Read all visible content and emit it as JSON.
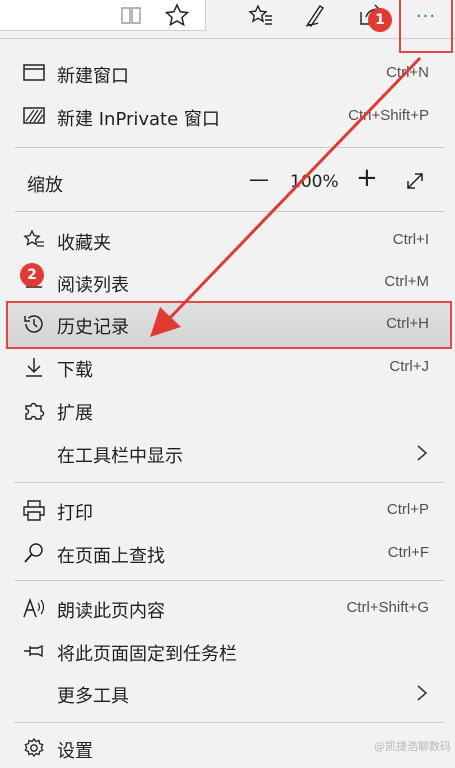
{
  "menu": {
    "new_window": {
      "label": "新建窗口",
      "shortcut": "Ctrl+N"
    },
    "new_inprivate": {
      "label": "新建 InPrivate 窗口",
      "shortcut": "Ctrl+Shift+P"
    },
    "zoom": {
      "label": "缩放",
      "minus": "—",
      "value": "100%",
      "plus": "+"
    },
    "favorites": {
      "label": "收藏夹",
      "shortcut": "Ctrl+I"
    },
    "reading_list": {
      "label": "阅读列表",
      "shortcut": "Ctrl+M"
    },
    "history": {
      "label": "历史记录",
      "shortcut": "Ctrl+H"
    },
    "downloads": {
      "label": "下载",
      "shortcut": "Ctrl+J"
    },
    "extensions": {
      "label": "扩展"
    },
    "show_in_toolbar": {
      "label": "在工具栏中显示"
    },
    "print": {
      "label": "打印",
      "shortcut": "Ctrl+P"
    },
    "find": {
      "label": "在页面上查找",
      "shortcut": "Ctrl+F"
    },
    "read_aloud": {
      "label": "朗读此页内容",
      "shortcut": "Ctrl+Shift+G"
    },
    "pin_taskbar": {
      "label": "将此页面固定到任务栏"
    },
    "more_tools": {
      "label": "更多工具"
    },
    "settings": {
      "label": "设置"
    }
  },
  "toolbar": {
    "more_label": "···"
  },
  "annotations": {
    "step1": "1",
    "step2": "2",
    "accent_color": "#e03a33"
  },
  "watermark": "@凯捷浩聊数码"
}
